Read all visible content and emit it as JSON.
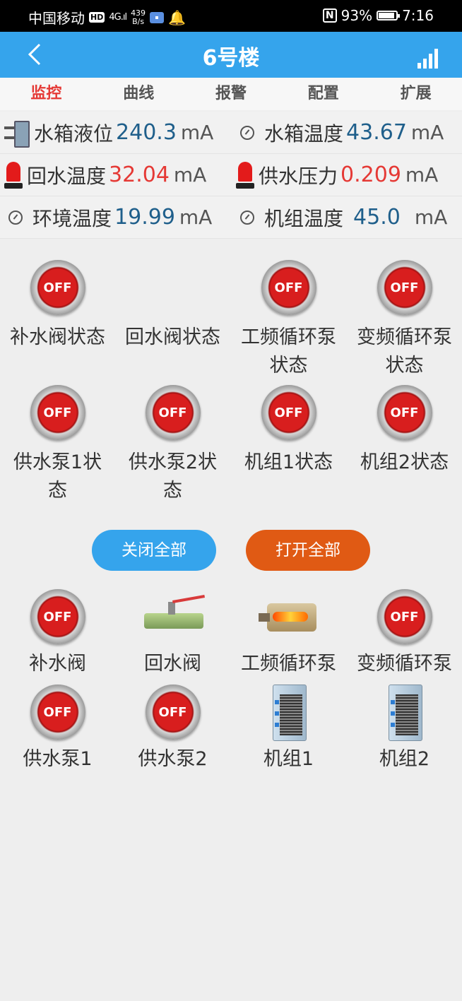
{
  "status_bar": {
    "carrier": "中国移动",
    "hd": "HD",
    "network": "4G",
    "speed_value": "439",
    "speed_unit": "B/s",
    "nfc": "N",
    "battery": "93%",
    "time": "7:16"
  },
  "header": {
    "back": "<",
    "title": "6号楼"
  },
  "tabs": [
    "监控",
    "曲线",
    "报警",
    "配置",
    "扩展"
  ],
  "readings": [
    {
      "label": "水箱液位",
      "value": "240.3",
      "unit": "mA",
      "icon": "tank-icon",
      "color": "#1f5f8b"
    },
    {
      "label": "水箱温度",
      "value": "43.67",
      "unit": "mA",
      "icon": "gauge-icon",
      "color": "#1f5f8b"
    },
    {
      "label": "回水温度",
      "value": "32.04",
      "unit": "mA",
      "icon": "siren-icon",
      "color": "#e53935"
    },
    {
      "label": "供水压力",
      "value": "0.209",
      "unit": "mA",
      "icon": "siren-icon",
      "color": "#e53935"
    },
    {
      "label": "环境温度",
      "value": "19.99",
      "unit": "mA",
      "icon": "gauge-icon",
      "color": "#1f5f8b"
    },
    {
      "label": "机组温度",
      "value": "45.0",
      "unit": "mA",
      "icon": "gauge-icon",
      "color": "#1f5f8b"
    }
  ],
  "status_items": [
    {
      "label": "补水阀状态",
      "state": "OFF"
    },
    {
      "label": "回水阀状态",
      "state": ""
    },
    {
      "label": "工频循环泵状态",
      "state": "OFF"
    },
    {
      "label": "变频循环泵状态",
      "state": "OFF"
    },
    {
      "label": "供水泵1状态",
      "state": "OFF"
    },
    {
      "label": "供水泵2状态",
      "state": "OFF"
    },
    {
      "label": "机组1状态",
      "state": "OFF"
    },
    {
      "label": "机组2状态",
      "state": "OFF"
    }
  ],
  "buttons": {
    "close_all": "关闭全部",
    "open_all": "打开全部"
  },
  "controls": [
    {
      "label": "补水阀",
      "state": "OFF",
      "icon": "off-button"
    },
    {
      "label": "回水阀",
      "state": "",
      "icon": "valve-icon"
    },
    {
      "label": "工频循环泵",
      "state": "",
      "icon": "boiler-icon"
    },
    {
      "label": "变频循环泵",
      "state": "OFF",
      "icon": "off-button"
    },
    {
      "label": "供水泵1",
      "state": "OFF",
      "icon": "off-button"
    },
    {
      "label": "供水泵2",
      "state": "OFF",
      "icon": "off-button"
    },
    {
      "label": "机组1",
      "state": "",
      "icon": "unit-icon"
    },
    {
      "label": "机组2",
      "state": "",
      "icon": "unit-icon"
    }
  ],
  "colors": {
    "header": "#35a4ec",
    "active_tab": "#e53935",
    "close_button": "#35a4ec",
    "open_button": "#e05a14"
  }
}
